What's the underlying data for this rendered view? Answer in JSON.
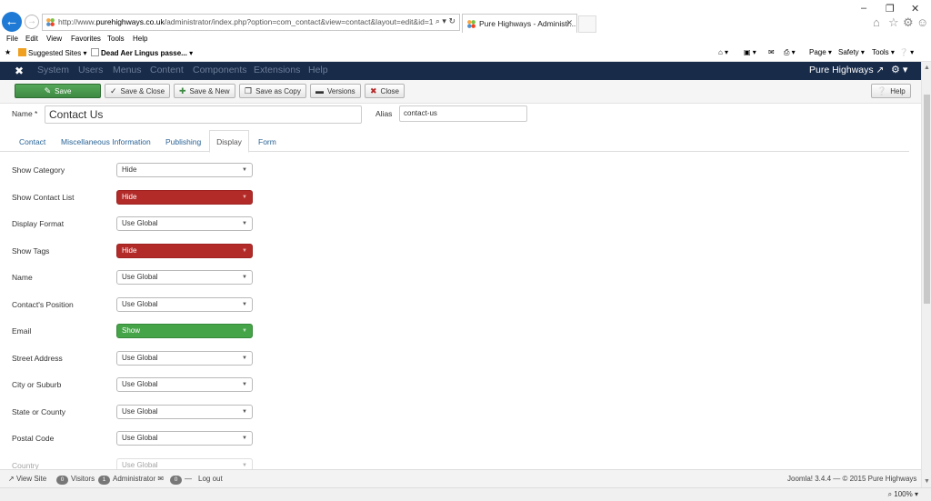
{
  "browser": {
    "url_prefix": "http://www.",
    "url_domain": "purehighways.co.uk",
    "url_path": "/administrator/index.php?option=com_contact&view=contact&layout=edit&id=1",
    "tab_title": "Pure Highways - Administr...",
    "menu": [
      "File",
      "Edit",
      "View",
      "Favorites",
      "Tools",
      "Help"
    ],
    "favorites": [
      "Suggested Sites ▾",
      "Dead Aer Lingus passe... ▾"
    ],
    "commands": [
      "Page ▾",
      "Safety ▾",
      "Tools ▾"
    ],
    "zoom": "100%"
  },
  "adminnav": {
    "items": [
      "System",
      "Users",
      "Menus",
      "Content",
      "Components",
      "Extensions",
      "Help"
    ],
    "site_name": "Pure Highways"
  },
  "toolbar": {
    "save": "Save",
    "save_close": "Save & Close",
    "save_new": "Save & New",
    "save_copy": "Save as Copy",
    "versions": "Versions",
    "close": "Close",
    "help": "Help"
  },
  "form": {
    "name_label": "Name *",
    "name_value": "Contact Us",
    "alias_label": "Alias",
    "alias_value": "contact-us"
  },
  "tabs": [
    "Contact",
    "Miscellaneous Information",
    "Publishing",
    "Display",
    "Form"
  ],
  "active_tab": "Display",
  "fields": [
    {
      "label": "Show Category",
      "value": "Hide",
      "style": "normal"
    },
    {
      "label": "Show Contact List",
      "value": "Hide",
      "style": "red"
    },
    {
      "label": "Display Format",
      "value": "Use Global",
      "style": "normal"
    },
    {
      "label": "Show Tags",
      "value": "Hide",
      "style": "red"
    },
    {
      "label": "Name",
      "value": "Use Global",
      "style": "normal"
    },
    {
      "label": "Contact's Position",
      "value": "Use Global",
      "style": "normal"
    },
    {
      "label": "Email",
      "value": "Show",
      "style": "green"
    },
    {
      "label": "Street Address",
      "value": "Use Global",
      "style": "normal"
    },
    {
      "label": "City or Suburb",
      "value": "Use Global",
      "style": "normal"
    },
    {
      "label": "State or County",
      "value": "Use Global",
      "style": "normal"
    },
    {
      "label": "Postal Code",
      "value": "Use Global",
      "style": "normal"
    },
    {
      "label": "Country",
      "value": "Use Global",
      "style": "faded"
    }
  ],
  "statusbar": {
    "view_site": "View Site",
    "visitors_count": "0",
    "visitors": "Visitors",
    "admin_count": "1",
    "admin": "Administrator",
    "msg_count": "0",
    "logout": "Log out",
    "version": "Joomla! 3.4.4 — © 2015 Pure Highways"
  },
  "colors": {
    "nav_bg": "#182b49",
    "save_green": "#46a04b",
    "hide_red": "#b32b29",
    "show_green": "#45a348",
    "link_blue": "#2a6496"
  }
}
